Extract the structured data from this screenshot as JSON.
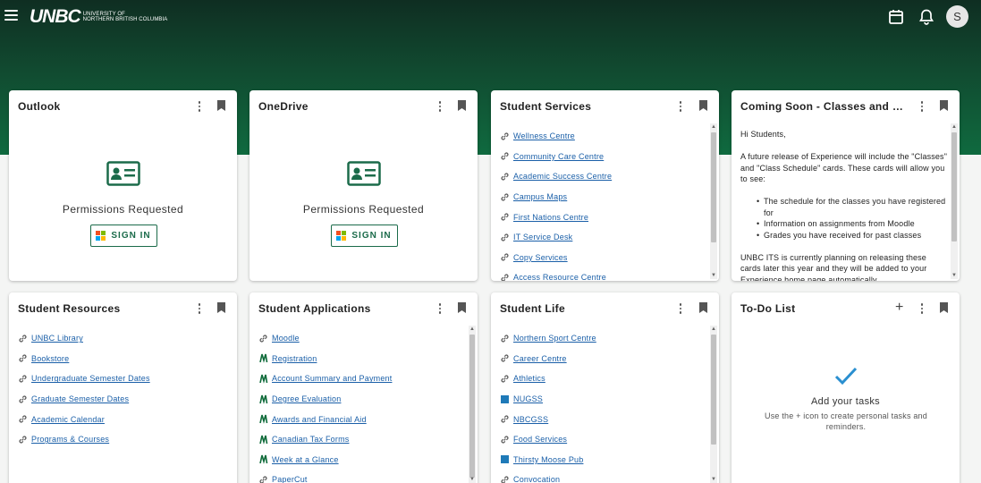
{
  "header": {
    "logo_mark": "UNBC",
    "logo_line1": "University of",
    "logo_line2": "Northern British Columbia",
    "avatar_initial": "S"
  },
  "cards": {
    "outlook": {
      "title": "Outlook",
      "permission_text": "Permissions Requested",
      "signin_label": "SIGN IN"
    },
    "onedrive": {
      "title": "OneDrive",
      "permission_text": "Permissions Requested",
      "signin_label": "SIGN IN"
    },
    "student_services": {
      "title": "Student Services",
      "links": [
        "Wellness Centre",
        "Community Care Centre",
        "Academic Success Centre",
        "Campus Maps",
        "First Nations Centre",
        "IT Service Desk",
        "Copy Services",
        "Access Resource Centre"
      ]
    },
    "coming_soon": {
      "title": "Coming Soon - Classes and Class Schedule",
      "greeting": "Hi Students,",
      "intro": "A future release of Experience will include the \"Classes\" and \"Class Schedule\" cards. These cards will allow you to see:",
      "bullets": [
        "The schedule for the classes you have registered for",
        "Information on assignments from Moodle",
        "Grades you have received for past classes"
      ],
      "outro": "UNBC ITS is currently planning on releasing these cards later this year and they will be added to your Experience home page automatically."
    },
    "student_resources": {
      "title": "Student Resources",
      "links": [
        "UNBC Library",
        "Bookstore",
        "Undergraduate Semester Dates",
        "Graduate Semester Dates",
        "Academic Calendar",
        "Programs & Courses"
      ]
    },
    "student_applications": {
      "title": "Student Applications",
      "links": [
        "Moodle",
        "Registration",
        "Account Summary and Payment",
        "Degree Evaluation",
        "Awards and Financial Aid",
        "Canadian Tax Forms",
        "Week at a Glance",
        "PaperCut"
      ]
    },
    "student_life": {
      "title": "Student Life",
      "links": [
        "Northern Sport Centre",
        "Career Centre",
        "Athletics",
        "NUGSS",
        "NBCGSS",
        "Food Services",
        "Thirsty Moose Pub",
        "Convocation"
      ]
    },
    "todo": {
      "title": "To-Do List",
      "empty_title": "Add your tasks",
      "empty_sub": "Use the + icon to create personal tasks and reminders."
    }
  },
  "colors": {
    "brand_green": "#1b6b4a",
    "link_blue": "#1a5fa8",
    "check_blue": "#2a8fd0"
  },
  "icons": [
    "menu-icon",
    "calendar-icon",
    "bell-icon",
    "more-vert-icon",
    "bookmark-icon",
    "link-icon",
    "ellucian-icon",
    "square-icon",
    "check-icon",
    "contact-card-icon",
    "plus-icon"
  ]
}
